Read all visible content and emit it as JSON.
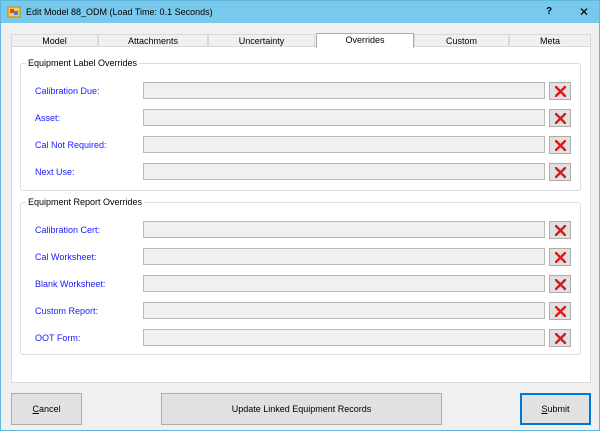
{
  "window": {
    "title": "Edit Model 88_ODM (Load Time: 0.1 Seconds)",
    "help": "?",
    "close": "✕"
  },
  "tabs": [
    {
      "label": "Model",
      "active": false
    },
    {
      "label": "Attachments",
      "active": false
    },
    {
      "label": "Uncertainty",
      "active": false
    },
    {
      "label": "Overrides",
      "active": true
    },
    {
      "label": "Custom",
      "active": false
    },
    {
      "label": "Meta",
      "active": false
    }
  ],
  "label_overrides": {
    "title": "Equipment Label Overrides",
    "fields": [
      {
        "label": "Calibration Due:",
        "value": ""
      },
      {
        "label": "Asset:",
        "value": ""
      },
      {
        "label": "Cal Not Required:",
        "value": ""
      },
      {
        "label": "Next Use:",
        "value": ""
      }
    ]
  },
  "report_overrides": {
    "title": "Equipment Report Overrides",
    "fields": [
      {
        "label": "Calibration Cert:",
        "value": ""
      },
      {
        "label": "Cal Worksheet:",
        "value": ""
      },
      {
        "label": "Blank Worksheet:",
        "value": ""
      },
      {
        "label": "Custom Report:",
        "value": ""
      },
      {
        "label": "OOT Form:",
        "value": ""
      }
    ]
  },
  "buttons": {
    "cancel_mnemonic": "C",
    "cancel_rest": "ancel",
    "update": "Update Linked Equipment Records",
    "submit_mnemonic": "S",
    "submit_rest": "ubmit"
  },
  "icons": {
    "clear": "red-x-icon",
    "app": "app-icon"
  },
  "colors": {
    "titlebar": "#79c9ec",
    "field_label": "#1a1aff",
    "clear_x": "#d81b1b",
    "default_button_border": "#0078d7"
  }
}
